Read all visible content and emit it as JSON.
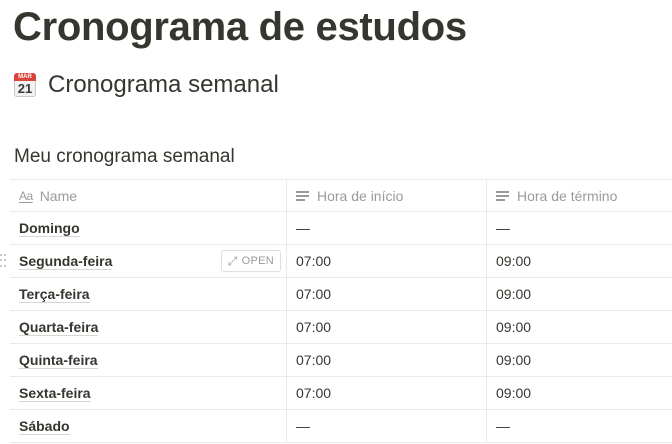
{
  "page": {
    "title": "Cronograma de estudos"
  },
  "section": {
    "icon": "calendar-icon",
    "icon_month": "MAR",
    "icon_day": "21",
    "heading": "Cronograma semanal"
  },
  "database": {
    "title": "Meu cronograma semanal",
    "columns": {
      "name": "Name",
      "start": "Hora de início",
      "end": "Hora de término"
    },
    "rows": [
      {
        "name": "Domingo",
        "start": "—",
        "end": "—"
      },
      {
        "name": "Segunda-feira",
        "start": "07:00",
        "end": "09:00"
      },
      {
        "name": "Terça-feira",
        "start": "07:00",
        "end": "09:00"
      },
      {
        "name": "Quarta-feira",
        "start": "07:00",
        "end": "09:00"
      },
      {
        "name": "Quinta-feira",
        "start": "07:00",
        "end": "09:00"
      },
      {
        "name": "Sexta-feira",
        "start": "07:00",
        "end": "09:00"
      },
      {
        "name": "Sábado",
        "start": "—",
        "end": "—"
      }
    ],
    "hovered_row_open_label": "OPEN",
    "header_name_icon": "Aa"
  },
  "colors": {
    "text": "#37352f",
    "muted": "#9b9a97",
    "border": "#e9e9e7",
    "calendar_red": "#d9453b"
  }
}
